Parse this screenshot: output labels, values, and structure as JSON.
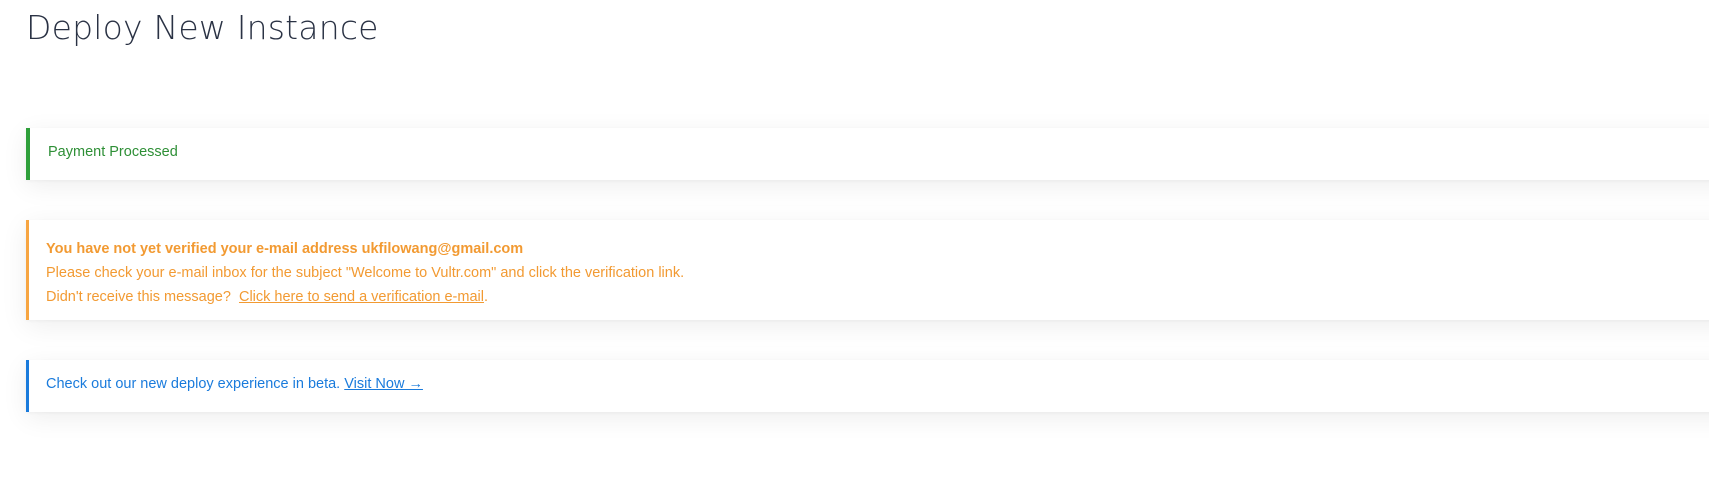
{
  "page": {
    "title": "Deploy New Instance"
  },
  "alerts": {
    "payment": {
      "text": "Payment Processed"
    },
    "verify_email": {
      "heading": "You have not yet verified your e-mail address ukfilowang@gmail.com",
      "instruction": "Please check your e-mail inbox for the subject \"Welcome to Vultr.com\" and click the verification link.",
      "prompt": "Didn't receive this message? ",
      "link_text": "Click here to send a verification e-mail",
      "trailing": "."
    },
    "beta": {
      "text": "Check out our new deploy experience in beta.",
      "link_text": "Visit Now →"
    }
  },
  "colors": {
    "success": "#2e9f3a",
    "warning": "#f7a541",
    "info": "#1a7bdc",
    "title": "#2a3244"
  }
}
